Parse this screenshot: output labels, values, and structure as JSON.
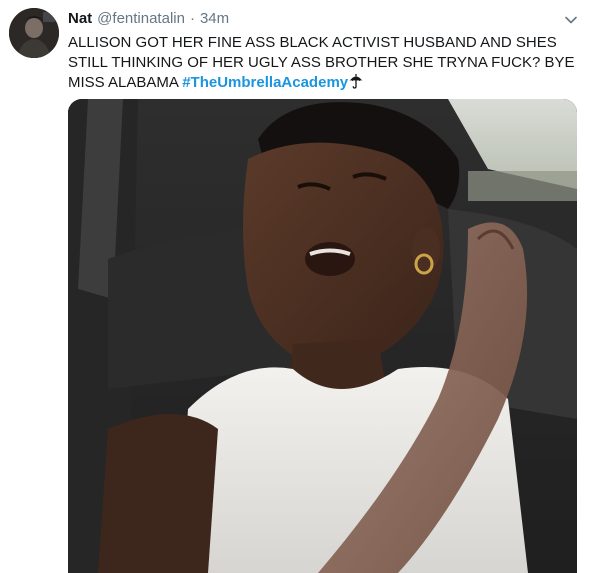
{
  "tweet": {
    "display_name": "Nat",
    "handle": "@fentinatalin",
    "separator": "·",
    "time": "34m",
    "text_before_hashtag": "ALLISON GOT HER FINE ASS BLACK ACTIVIST HUSBAND AND SHES STILL THINKING OF HER UGLY ASS BROTHER SHE TRYNA FUCK? BYE MISS ALABAMA ",
    "hashtag": "#TheUmbrellaAcademy"
  },
  "icons": {
    "avatar": "profile-avatar",
    "caret": "chevron-down-icon",
    "hashtag_emoji": "umbrella-icon"
  },
  "colors": {
    "name": "#14171a",
    "secondary": "#657786",
    "hashtag": "#1b95e0",
    "background": "#ffffff"
  }
}
